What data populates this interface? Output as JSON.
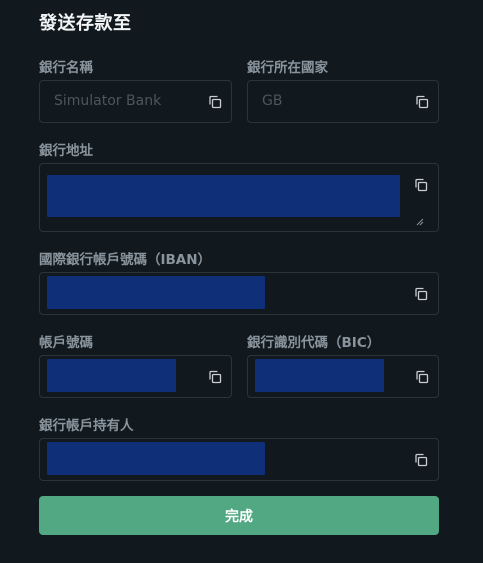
{
  "dialog": {
    "title": "發送存款至"
  },
  "fields": {
    "bank_name": {
      "label": "銀行名稱",
      "placeholder": "Simulator Bank"
    },
    "bank_country": {
      "label": "銀行所在國家",
      "placeholder": "GB"
    },
    "bank_address": {
      "label": "銀行地址"
    },
    "iban": {
      "label": "國際銀行帳戶號碼（IBAN）"
    },
    "account_number": {
      "label": "帳戶號碼"
    },
    "bic": {
      "label": "銀行識別代碼（BIC）"
    },
    "account_holder": {
      "label": "銀行帳戶持有人"
    }
  },
  "actions": {
    "done_label": "完成"
  },
  "icons": {
    "copy": "copy-icon",
    "resize": "resize-handle-icon"
  },
  "colors": {
    "background": "#11191f",
    "field_border": "#2b343b",
    "label": "#8a949c",
    "redaction": "#0f2f78",
    "primary_button": "#52a882"
  }
}
